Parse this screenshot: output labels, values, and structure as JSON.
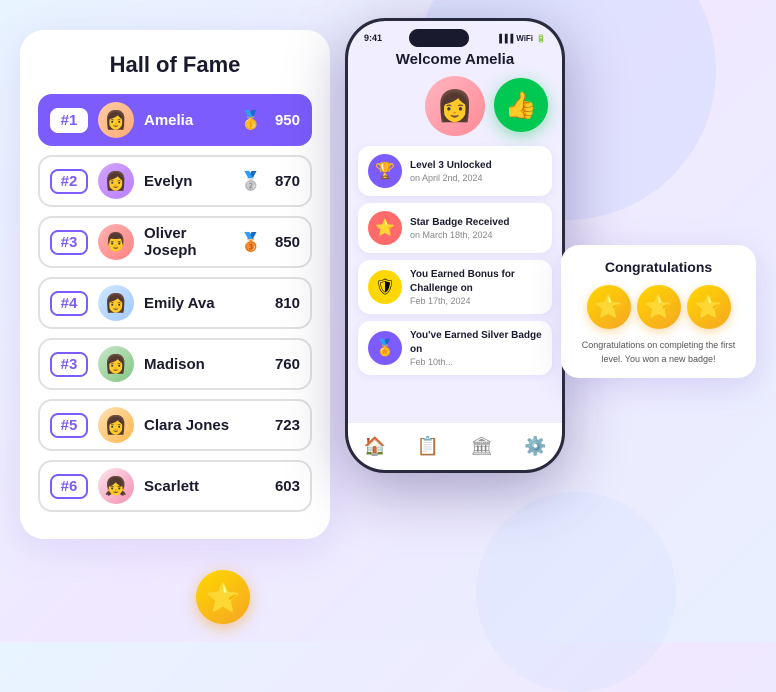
{
  "page": {
    "background": "#e8f0ff"
  },
  "hall_of_fame": {
    "title": "Hall of Fame",
    "rows": [
      {
        "rank": "#1",
        "name": "Amelia",
        "score": "950",
        "medal": "🥇",
        "top": true,
        "face_class": "face-amelia",
        "emoji": "👩"
      },
      {
        "rank": "#2",
        "name": "Evelyn",
        "score": "870",
        "medal": "🥈",
        "top": false,
        "face_class": "face-evelyn",
        "emoji": "👩"
      },
      {
        "rank": "#3",
        "name": "Oliver Joseph",
        "score": "850",
        "medal": "🥉",
        "top": false,
        "face_class": "face-oliver",
        "emoji": "👨"
      },
      {
        "rank": "#4",
        "name": "Emily Ava",
        "score": "810",
        "medal": "",
        "top": false,
        "face_class": "face-emily",
        "emoji": "👩"
      },
      {
        "rank": "#3",
        "name": "Madison",
        "score": "760",
        "medal": "",
        "top": false,
        "face_class": "face-madison",
        "emoji": "👩"
      },
      {
        "rank": "#5",
        "name": "Clara Jones",
        "score": "723",
        "medal": "",
        "top": false,
        "face_class": "face-clara",
        "emoji": "👩"
      },
      {
        "rank": "#6",
        "name": "Scarlett",
        "score": "603",
        "medal": "",
        "top": false,
        "face_class": "face-scarlett",
        "emoji": "👧"
      }
    ]
  },
  "phone": {
    "time": "9:41",
    "welcome": "Welcome Amelia",
    "activities": [
      {
        "icon": "🏆",
        "icon_bg": "#7c5cfc",
        "title": "Level 3 Unlocked",
        "subtitle": "on April 2nd, 2024"
      },
      {
        "icon": "⭐",
        "icon_bg": "#ff6b6b",
        "title": "Star Badge Received",
        "subtitle": "on March 18th, 2024"
      },
      {
        "icon": "🛡",
        "icon_bg": "#ffd700",
        "title": "You Earned Bonus for Challenge on",
        "subtitle": "Feb 17th, 2024"
      },
      {
        "icon": "🏅",
        "icon_bg": "#7c5cfc",
        "title": "You've Earned Silver Badge on",
        "subtitle": "Feb 10th..."
      }
    ],
    "nav": [
      "🏠",
      "📋",
      "🏛",
      "⚙️"
    ]
  },
  "congrats": {
    "title": "Congratulations",
    "stars": [
      "⭐",
      "⭐",
      "⭐"
    ],
    "text": "Congratulations on completing the first level. You won a new badge!"
  },
  "thumbs_up": "👍",
  "medal_star": "⭐"
}
